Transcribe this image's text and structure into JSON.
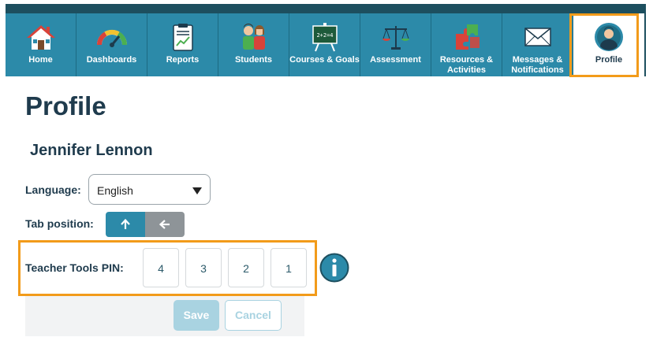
{
  "nav": {
    "tabs": [
      {
        "id": "home",
        "label": "Home",
        "icon": "house-icon"
      },
      {
        "id": "dashboards",
        "label": "Dashboards",
        "icon": "gauge-icon"
      },
      {
        "id": "reports",
        "label": "Reports",
        "icon": "clipboard-chart-icon"
      },
      {
        "id": "students",
        "label": "Students",
        "icon": "students-icon"
      },
      {
        "id": "courses",
        "label": "Courses & Goals",
        "icon": "easel-icon"
      },
      {
        "id": "assessment",
        "label": "Assessment",
        "icon": "scales-icon"
      },
      {
        "id": "resources",
        "label": "Resources & Activities",
        "icon": "puzzle-icon"
      },
      {
        "id": "messages",
        "label": "Messages & Notifications",
        "icon": "envelope-icon"
      },
      {
        "id": "profile",
        "label": "Profile",
        "icon": "profile-avatar-icon"
      }
    ],
    "active": "profile",
    "colors": {
      "bar": "#1d4f5f",
      "tab": "#2c8aa9",
      "highlight": "#f29b1a"
    }
  },
  "page": {
    "title": "Profile",
    "user_name": "Jennifer Lennon"
  },
  "language": {
    "label": "Language:",
    "selected": "English"
  },
  "tab_position": {
    "label": "Tab position:",
    "options": [
      "up-arrow-icon",
      "left-arrow-icon"
    ],
    "selected": "up"
  },
  "pin": {
    "label": "Teacher Tools PIN:",
    "digits": [
      "4",
      "3",
      "2",
      "1"
    ],
    "info_icon": "info-icon"
  },
  "actions": {
    "save_label": "Save",
    "cancel_label": "Cancel"
  }
}
